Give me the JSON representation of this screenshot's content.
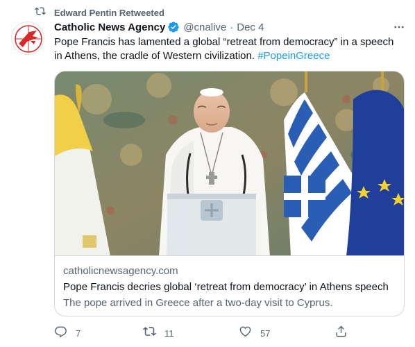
{
  "retweet": {
    "text": "Edward Pentin Retweeted",
    "icon": "retweet-icon"
  },
  "tweet": {
    "author_name": "Catholic News Agency",
    "handle": "@cnalive",
    "separator": "·",
    "date": "Dec 4",
    "verified_icon": "verified-badge-icon",
    "avatar_icon": "cna-logo",
    "more_icon": "more-icon",
    "text_main": "Pope Francis has lamented a global “retreat from democracy” in a speech in Athens, the cradle of Western civilization. ",
    "hashtag": "#PopeinGreece"
  },
  "card": {
    "domain": "catholicnewsagency.com",
    "title": "Pope Francis decries global ‘retreat from democracy’ in Athens speech",
    "description": "The pope arrived in Greece after a two-day visit to Cyprus."
  },
  "actions": {
    "reply": {
      "icon": "reply-icon",
      "count": "7"
    },
    "retweet": {
      "icon": "retweet-icon",
      "count": "11"
    },
    "like": {
      "icon": "heart-icon",
      "count": "57"
    },
    "share": {
      "icon": "share-icon"
    }
  },
  "colors": {
    "text_primary": "#0f1419",
    "text_secondary": "#536471",
    "accent": "#1d9bf0",
    "border": "#cfd9de",
    "logo_red": "#d52b2b"
  }
}
